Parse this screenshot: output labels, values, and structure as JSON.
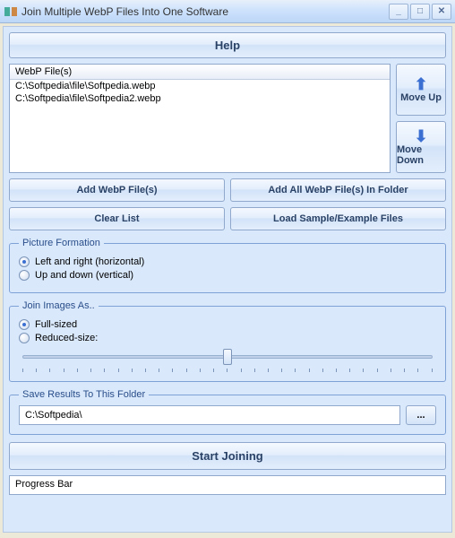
{
  "window": {
    "title": "Join Multiple WebP Files Into One Software",
    "help_label": "Help"
  },
  "file_list": {
    "header": "WebP File(s)",
    "items": [
      "C:\\Softpedia\\file\\Softpedia.webp",
      "C:\\Softpedia\\file\\Softpedia2.webp"
    ],
    "move_up_label": "Move Up",
    "move_down_label": "Move Down"
  },
  "buttons": {
    "add_files": "Add WebP File(s)",
    "add_folder": "Add All WebP File(s) In Folder",
    "clear": "Clear List",
    "load_sample": "Load Sample/Example Files"
  },
  "formation": {
    "legend": "Picture Formation",
    "horizontal": "Left and right (horizontal)",
    "vertical": "Up and down (vertical)",
    "selected": "horizontal"
  },
  "join_as": {
    "legend": "Join Images As..",
    "full": "Full-sized",
    "reduced": "Reduced-size:",
    "selected": "full",
    "slider_value": 50
  },
  "save": {
    "legend": "Save Results To This Folder",
    "path": "C:\\Softpedia\\",
    "browse_label": "..."
  },
  "start_label": "Start Joining",
  "progress_label": "Progress Bar"
}
